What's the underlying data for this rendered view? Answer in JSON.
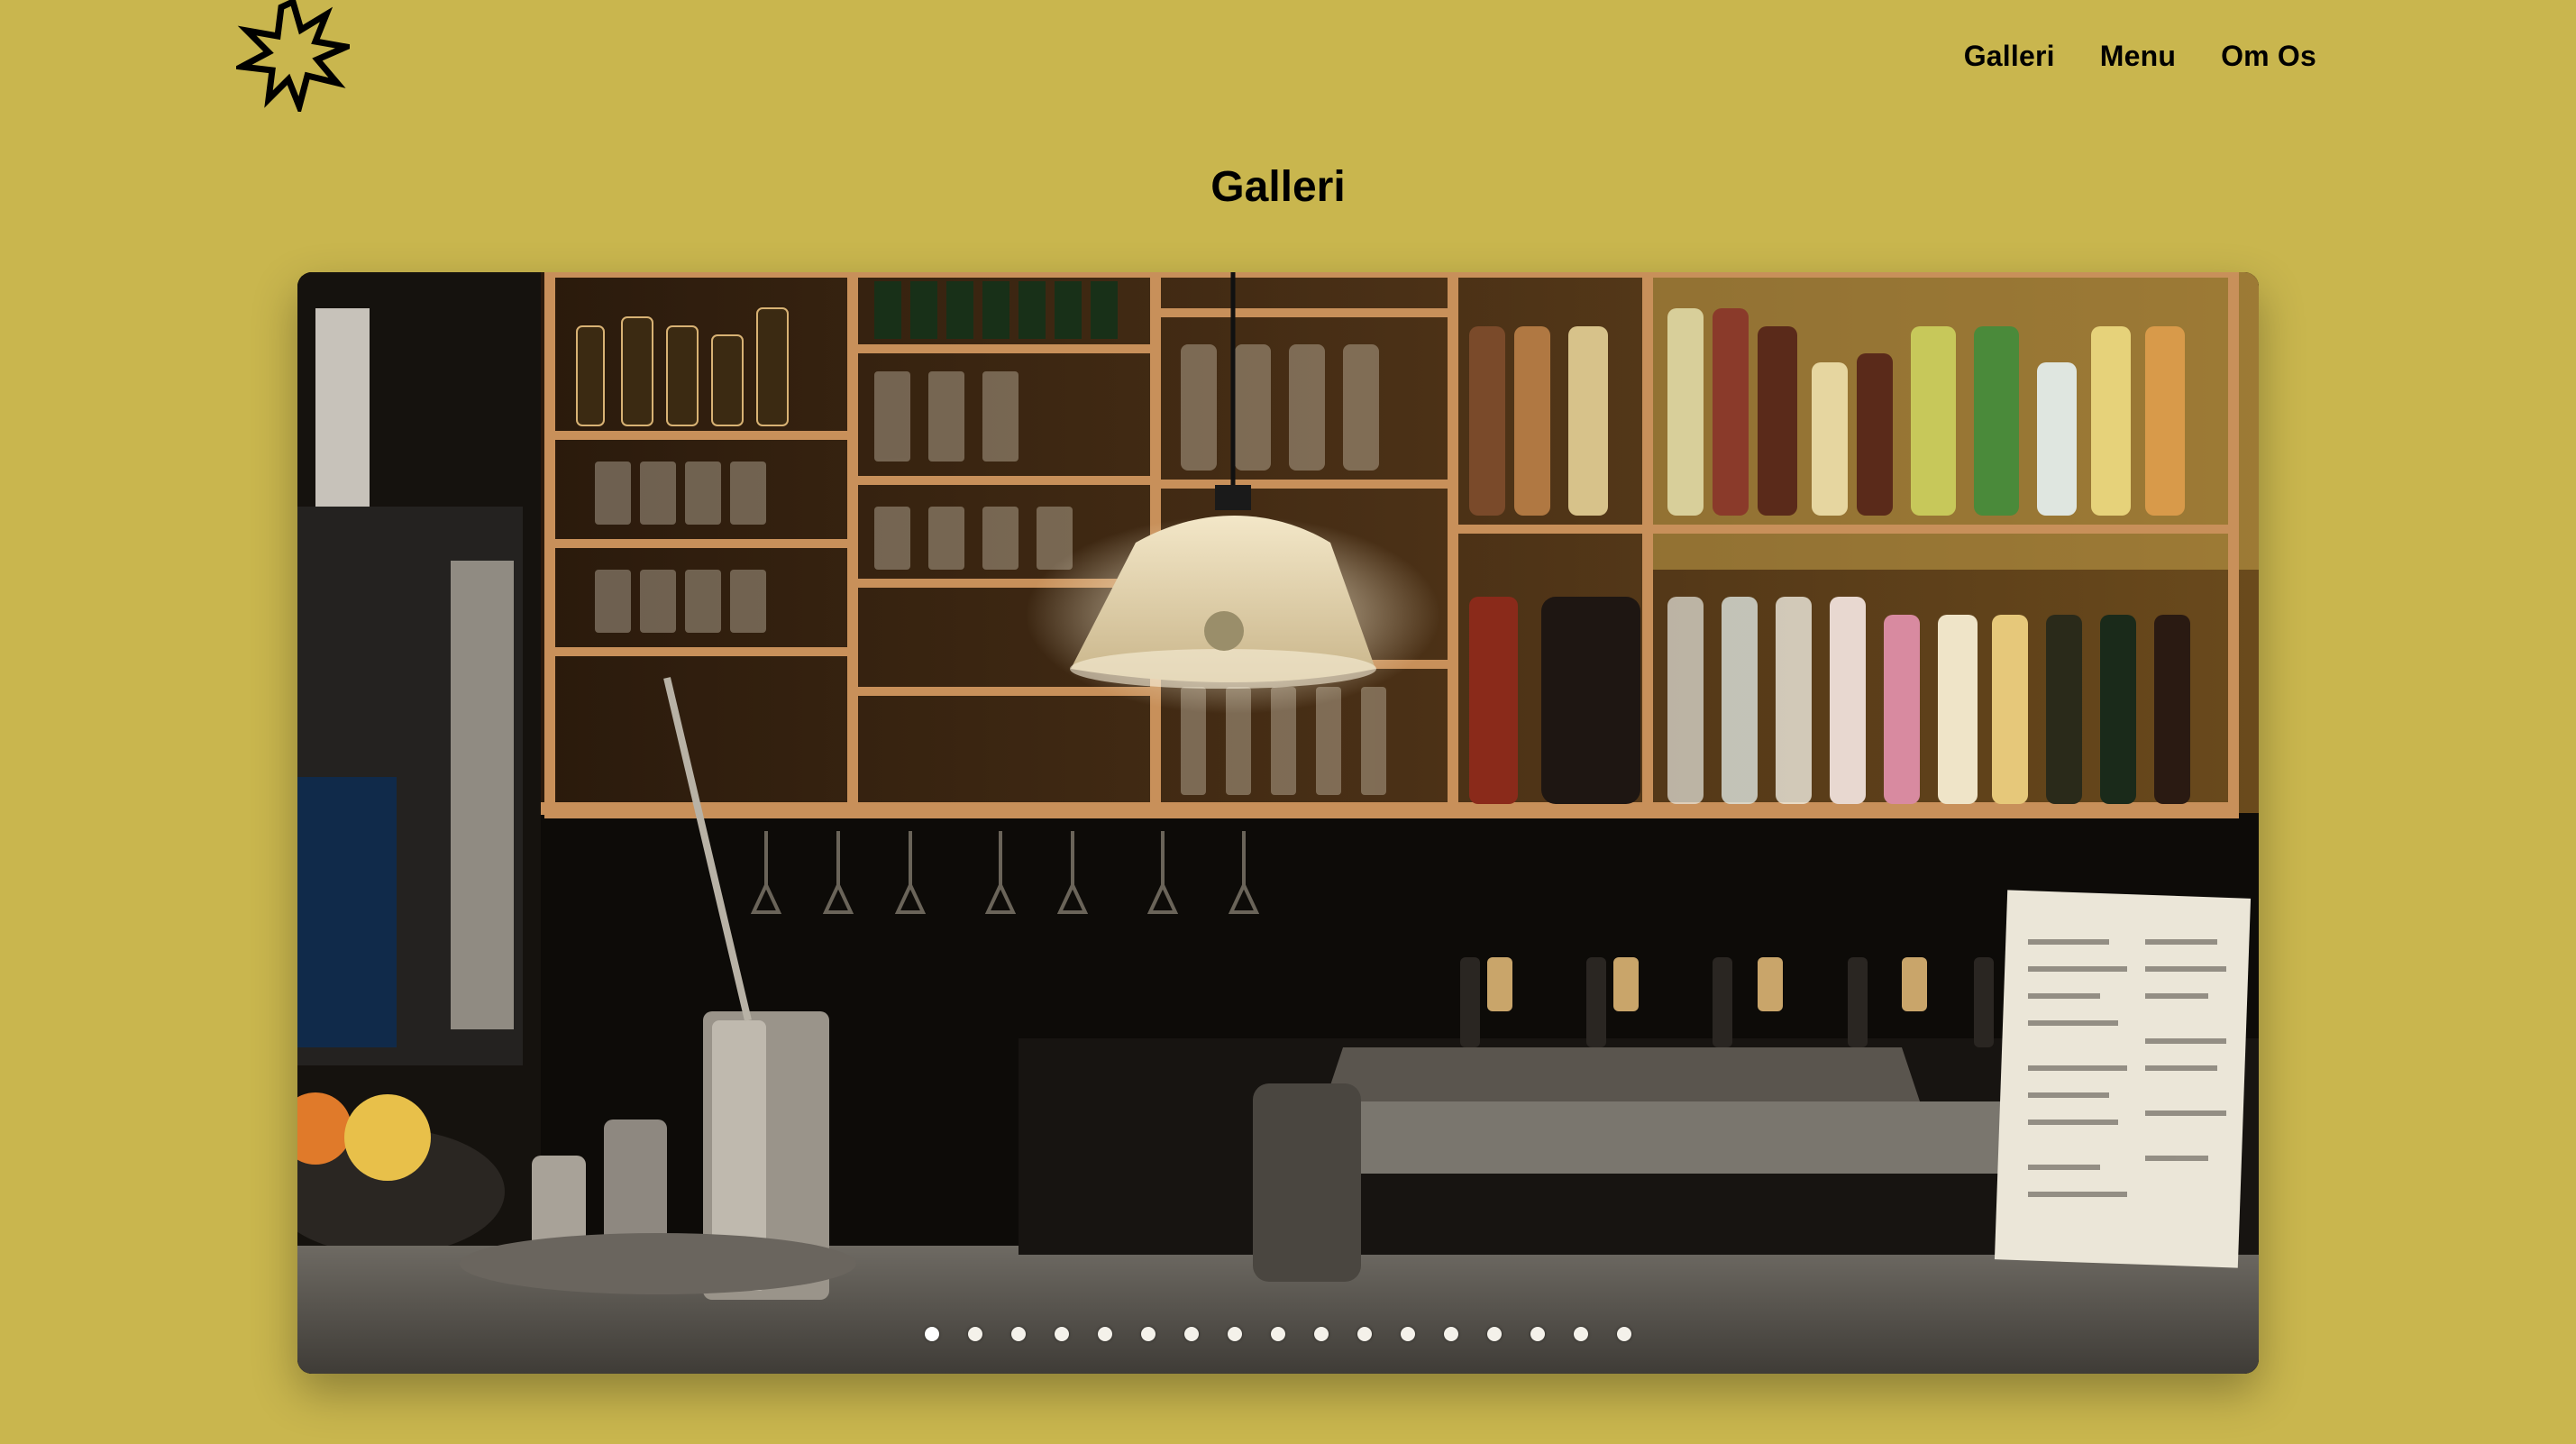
{
  "brand": {
    "logo_icon": "star-burst-icon"
  },
  "nav": {
    "items": [
      {
        "label": "Galleri"
      },
      {
        "label": "Menu"
      },
      {
        "label": "Om Os"
      }
    ]
  },
  "page": {
    "title": "Galleri"
  },
  "gallery": {
    "slide_count": 17,
    "active_index": 0
  },
  "colors": {
    "background": "#c9b64e",
    "text": "#000000",
    "dot": "#f4f1ea"
  }
}
